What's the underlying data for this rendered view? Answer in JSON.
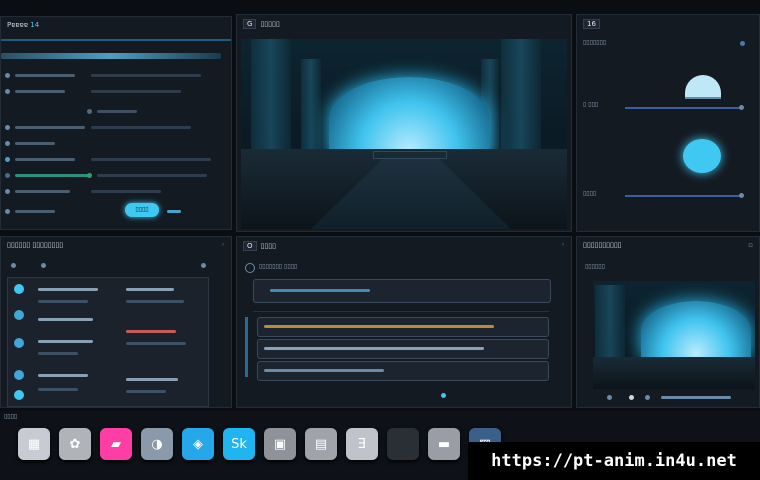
{
  "panels": {
    "top_left": {
      "title": "Pɐɐɐɐ",
      "badge": "14",
      "button_label": "▯▯▯▯"
    },
    "top_center": {
      "icon": "G",
      "title": "▯▯▯▯▯"
    },
    "top_right": {
      "badge": "16",
      "row1": "▯▯▯▯▯▯▯",
      "row2": "▯ ▯▯▯",
      "row3": "▯▯▯▯"
    },
    "mid_left": {
      "title": "▯▯▯▯▯▯ ▯▯▯▯▯▯▯▯"
    },
    "mid_center": {
      "icon": "O",
      "title": "▯▯▯▯",
      "sub": "▯▯▯▯▯▯▯ ▯▯▯▯"
    },
    "mid_right": {
      "title": "▯▯▯▯▯▯▯▯▯▯",
      "sub": "▯▯▯▯▯▯"
    }
  },
  "colors": {
    "accent": "#3fc9f2",
    "panel_bg": "#141a22",
    "border": "#232b36"
  },
  "dock": {
    "label": "▯▯▯▯",
    "items": [
      {
        "name": "finder-icon",
        "glyph": "▦",
        "color": "#c8ccd2"
      },
      {
        "name": "photos-icon",
        "glyph": "✿",
        "color": "#b0b4b8"
      },
      {
        "name": "pink-app-icon",
        "glyph": "▰",
        "color": "#ff3ea5"
      },
      {
        "name": "gray-app-icon",
        "glyph": "◑",
        "color": "#8a9aaa"
      },
      {
        "name": "blue-app-icon",
        "glyph": "◈",
        "color": "#25a7ea"
      },
      {
        "name": "cyan-app-icon",
        "glyph": "Sk",
        "color": "#1fb5f0"
      },
      {
        "name": "preview-icon",
        "glyph": "▣",
        "color": "#8f9399"
      },
      {
        "name": "files-icon",
        "glyph": "▤",
        "color": "#a0a4aa"
      },
      {
        "name": "text-editor-icon",
        "glyph": "Ǝ",
        "color": "#c0c4ca"
      },
      {
        "name": "dark-app-icon",
        "glyph": " ",
        "color": "#2a2f36"
      },
      {
        "name": "folder-icon",
        "glyph": "▬",
        "color": "#9a9ea4"
      },
      {
        "name": "image-icon",
        "glyph": "▨",
        "color": "#3a5f8a"
      }
    ]
  },
  "watermark": "https://pt-anim.in4u.net"
}
